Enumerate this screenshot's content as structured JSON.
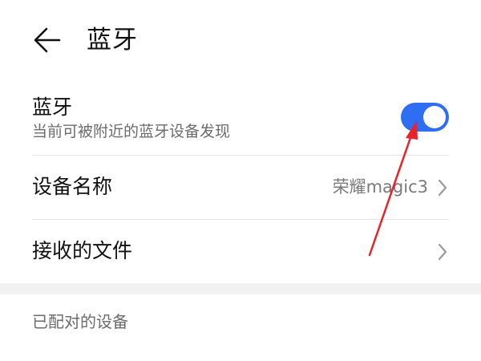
{
  "header": {
    "back_icon": "arrow-left-icon",
    "title": "蓝牙"
  },
  "bluetooth": {
    "title": "蓝牙",
    "subtitle": "当前可被附近的蓝牙设备发现",
    "toggle_on": true,
    "toggle_color": "#2f6ef2"
  },
  "device_name": {
    "label": "设备名称",
    "value": "荣耀magic3",
    "chevron_icon": "chevron-right-icon"
  },
  "received_files": {
    "label": "接收的文件",
    "chevron_icon": "chevron-right-icon"
  },
  "paired_section": {
    "header": "已配对的设备"
  },
  "annotation": {
    "arrow_color": "#e8232a"
  }
}
